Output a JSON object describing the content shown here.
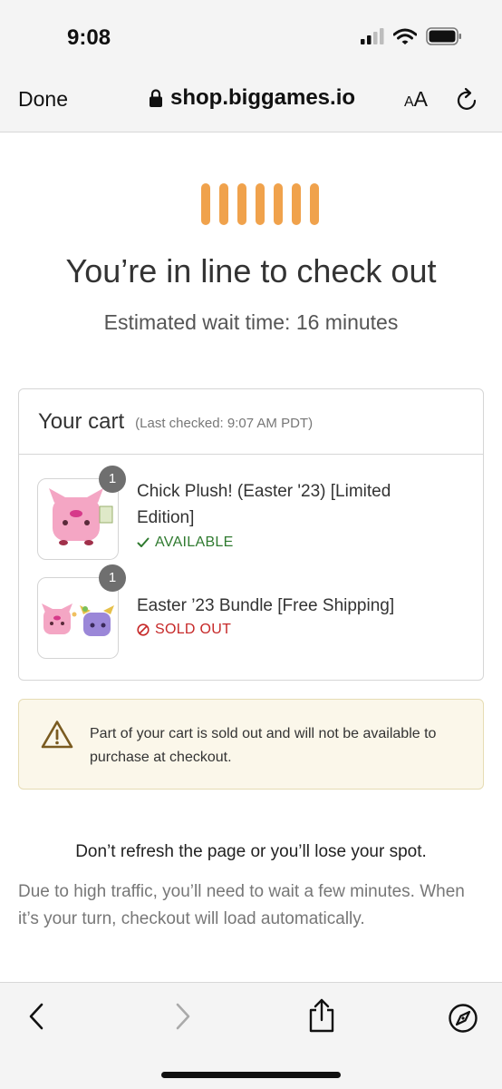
{
  "status_bar": {
    "time": "9:08",
    "icons": [
      "signal-icon",
      "wifi-icon",
      "battery-icon"
    ]
  },
  "browser": {
    "done_label": "Done",
    "url": "shop.biggames.io",
    "text_size_label_small": "A",
    "text_size_label_big": "A",
    "icons": [
      "lock-icon",
      "reload-icon"
    ]
  },
  "queue": {
    "headline": "You’re in line to check out",
    "wait_time": "Estimated wait time: 16 minutes",
    "loader_color": "#f0a24c"
  },
  "cart": {
    "title": "Your cart",
    "last_checked": "(Last checked: 9:07 AM PDT)",
    "items": [
      {
        "name": "Chick Plush! (Easter '23) [Limited Edition]",
        "quantity": "1",
        "status": "AVAILABLE",
        "status_color": "#2f7a2f",
        "status_icon": "checkmark-icon"
      },
      {
        "name": "Easter ’23 Bundle [Free Shipping]",
        "quantity": "1",
        "status": "SOLD OUT",
        "status_color": "#c62828",
        "status_icon": "prohibited-icon"
      }
    ]
  },
  "warning": {
    "icon": "warning-icon",
    "text": "Part of your cart is sold out and will not be available to purchase at checkout."
  },
  "notice": {
    "heading": "Don’t refresh the page or you’ll lose your spot.",
    "body": "Due to high traffic, you’ll need to wait a few minutes. When it’s your turn, checkout will load automatically."
  },
  "toolbar": {
    "icons": [
      "back-icon",
      "forward-icon",
      "share-icon",
      "compass-icon"
    ]
  }
}
